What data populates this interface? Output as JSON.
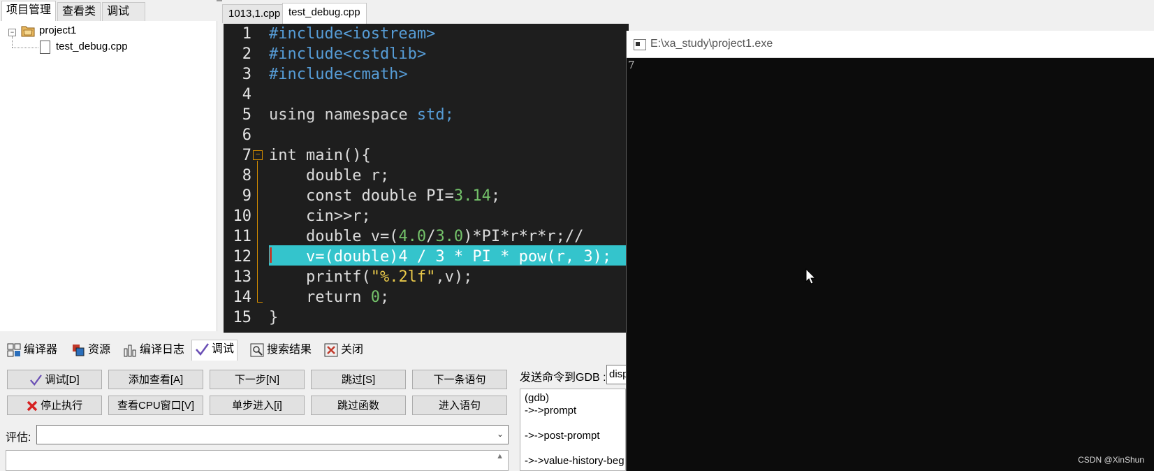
{
  "left_panel": {
    "tabs": [
      {
        "label": "项目管理",
        "active": true
      },
      {
        "label": "查看类",
        "active": false
      },
      {
        "label": "调试",
        "active": false
      }
    ],
    "tree": {
      "project": "project1",
      "files": [
        "test_debug.cpp"
      ]
    }
  },
  "editor": {
    "tabs": [
      {
        "label": "1013,1.cpp",
        "active": false
      },
      {
        "label": "test_debug.cpp",
        "active": true
      }
    ],
    "lines": [
      "1",
      "2",
      "3",
      "4",
      "5",
      "6",
      "7",
      "8",
      "9",
      "10",
      "11",
      "12",
      "13",
      "14",
      "15"
    ],
    "code": {
      "l1": "#include<iostream>",
      "l2": "#include<cstdlib>",
      "l3": "#include<cmath>",
      "l5a": "using namespace ",
      "l5b": "std;",
      "l7": "int main(){",
      "l8": "    double r;",
      "l9a": "    const double PI=",
      "l9b": "3.14",
      "l9c": ";",
      "l10": "    cin>>r;",
      "l11a": "    double v=(",
      "l11b": "4.0",
      "l11c": "/",
      "l11d": "3.0",
      "l11e": ")*PI*r*r*r;//",
      "l12": "    v=(double)4 / 3 * PI * pow(r, 3);",
      "l13a": "    printf(",
      "l13b": "\"%.2lf\"",
      "l13c": ",v);",
      "l14a": "    return ",
      "l14b": "0",
      "l14c": ";",
      "l15": "}"
    },
    "highlight_color": "#34c4cc",
    "background": "#1e1e1e"
  },
  "console": {
    "title": "E:\\xa_study\\project1.exe",
    "output": "7"
  },
  "bottom_panel": {
    "tabs": [
      {
        "label": "编译器",
        "icon": "grid-icon"
      },
      {
        "label": "资源",
        "icon": "resources-icon"
      },
      {
        "label": "编译日志",
        "icon": "bar-chart-icon"
      },
      {
        "label": "调试",
        "icon": "check-icon",
        "active": true
      },
      {
        "label": "搜索结果",
        "icon": "search-icon"
      },
      {
        "label": "关闭",
        "icon": "close-icon"
      }
    ],
    "buttons": {
      "debug": "调试[D]",
      "add_watch": "添加查看[A]",
      "next_step": "下一步[N]",
      "skip": "跳过[S]",
      "next_statement": "下一条语句",
      "stop": "停止执行",
      "cpu_window": "查看CPU窗口[V]",
      "step_into": "单步进入[i]",
      "skip_function": "跳过函数",
      "enter_statement": "进入语句"
    },
    "eval_label": "评估:",
    "gdb_label": "发送命令到GDB :",
    "gdb_input": "disp",
    "gdb_log": [
      "(gdb)",
      "->->prompt",
      "->->post-prompt",
      "->->value-history-beg"
    ]
  },
  "watermark": "CSDN @XinShun"
}
